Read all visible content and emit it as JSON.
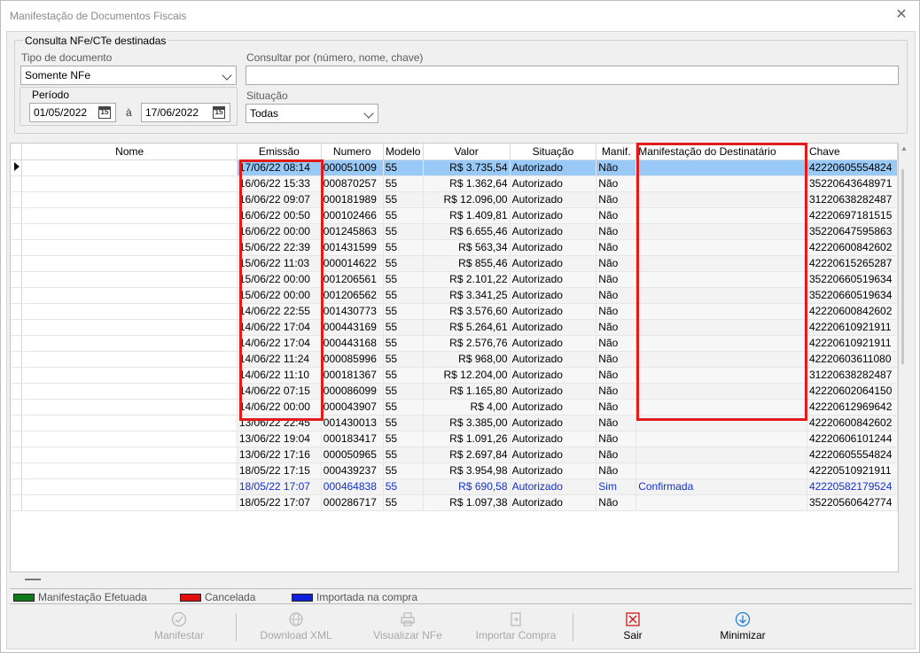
{
  "window": {
    "title": "Manifestação de Documentos Fiscais"
  },
  "filters": {
    "group_title": "Consulta NFe/CTe destinadas",
    "tipo_label": "Tipo de documento",
    "tipo_value": "Somente NFe",
    "consultar_label": "Consultar por (número, nome, chave)",
    "consultar_value": "",
    "periodo_label": "Período",
    "date_from": "01/05/2022",
    "date_sep": "à",
    "date_to": "17/06/2022",
    "calendar_glyph": "15",
    "situacao_label": "Situação",
    "situacao_value": "Todas"
  },
  "grid": {
    "columns": [
      "Nome",
      "Emissão",
      "Numero",
      "Modelo",
      "Valor",
      "Situação",
      "Manif.",
      "Manifestação do Destinatário",
      "Chave"
    ],
    "rows": [
      {
        "nome": "",
        "emissao": "17/06/22 08:14",
        "numero": "000051009",
        "modelo": "55",
        "valor": "R$ 3.735,54",
        "situacao": "Autorizado",
        "manif": "Não",
        "manifestacao": "",
        "chave": "42220605554824"
      },
      {
        "nome": "",
        "emissao": "16/06/22 15:33",
        "numero": "000870257",
        "modelo": "55",
        "valor": "R$ 1.362,64",
        "situacao": "Autorizado",
        "manif": "Não",
        "manifestacao": "",
        "chave": "35220643648971"
      },
      {
        "nome": "",
        "emissao": "16/06/22 09:07",
        "numero": "000181989",
        "modelo": "55",
        "valor": "R$ 12.096,00",
        "situacao": "Autorizado",
        "manif": "Não",
        "manifestacao": "",
        "chave": "31220638282487"
      },
      {
        "nome": "",
        "emissao": "16/06/22 00:50",
        "numero": "000102466",
        "modelo": "55",
        "valor": "R$ 1.409,81",
        "situacao": "Autorizado",
        "manif": "Não",
        "manifestacao": "",
        "chave": "42220697181515"
      },
      {
        "nome": "",
        "emissao": "16/06/22 00:00",
        "numero": "001245863",
        "modelo": "55",
        "valor": "R$ 6.655,46",
        "situacao": "Autorizado",
        "manif": "Não",
        "manifestacao": "",
        "chave": "35220647595863"
      },
      {
        "nome": "",
        "emissao": "15/06/22 22:39",
        "numero": "001431599",
        "modelo": "55",
        "valor": "R$ 563,34",
        "situacao": "Autorizado",
        "manif": "Não",
        "manifestacao": "",
        "chave": "42220600842602"
      },
      {
        "nome": "",
        "emissao": "15/06/22 11:03",
        "numero": "000014622",
        "modelo": "55",
        "valor": "R$ 855,46",
        "situacao": "Autorizado",
        "manif": "Não",
        "manifestacao": "",
        "chave": "42220615265287"
      },
      {
        "nome": "",
        "emissao": "15/06/22 00:00",
        "numero": "001206561",
        "modelo": "55",
        "valor": "R$ 2.101,22",
        "situacao": "Autorizado",
        "manif": "Não",
        "manifestacao": "",
        "chave": "35220660519634"
      },
      {
        "nome": "",
        "emissao": "15/06/22 00:00",
        "numero": "001206562",
        "modelo": "55",
        "valor": "R$ 3.341,25",
        "situacao": "Autorizado",
        "manif": "Não",
        "manifestacao": "",
        "chave": "35220660519634"
      },
      {
        "nome": "",
        "emissao": "14/06/22 22:55",
        "numero": "001430773",
        "modelo": "55",
        "valor": "R$ 3.576,60",
        "situacao": "Autorizado",
        "manif": "Não",
        "manifestacao": "",
        "chave": "42220600842602"
      },
      {
        "nome": "",
        "emissao": "14/06/22 17:04",
        "numero": "000443169",
        "modelo": "55",
        "valor": "R$ 5.264,61",
        "situacao": "Autorizado",
        "manif": "Não",
        "manifestacao": "",
        "chave": "42220610921911"
      },
      {
        "nome": "",
        "emissao": "14/06/22 17:04",
        "numero": "000443168",
        "modelo": "55",
        "valor": "R$ 2.576,76",
        "situacao": "Autorizado",
        "manif": "Não",
        "manifestacao": "",
        "chave": "42220610921911"
      },
      {
        "nome": "",
        "emissao": "14/06/22 11:24",
        "numero": "000085996",
        "modelo": "55",
        "valor": "R$ 968,00",
        "situacao": "Autorizado",
        "manif": "Não",
        "manifestacao": "",
        "chave": "42220603611080"
      },
      {
        "nome": "",
        "emissao": "14/06/22 11:10",
        "numero": "000181367",
        "modelo": "55",
        "valor": "R$ 12.204,00",
        "situacao": "Autorizado",
        "manif": "Não",
        "manifestacao": "",
        "chave": "31220638282487"
      },
      {
        "nome": "",
        "emissao": "14/06/22 07:15",
        "numero": "000086099",
        "modelo": "55",
        "valor": "R$ 1.165,80",
        "situacao": "Autorizado",
        "manif": "Não",
        "manifestacao": "",
        "chave": "42220602064150"
      },
      {
        "nome": "",
        "emissao": "14/06/22 00:00",
        "numero": "000043907",
        "modelo": "55",
        "valor": "R$ 4,00",
        "situacao": "Autorizado",
        "manif": "Não",
        "manifestacao": "",
        "chave": "42220612969642"
      },
      {
        "nome": "",
        "emissao": "13/06/22 22:45",
        "numero": "001430013",
        "modelo": "55",
        "valor": "R$ 3.385,00",
        "situacao": "Autorizado",
        "manif": "Não",
        "manifestacao": "",
        "chave": "42220600842602"
      },
      {
        "nome": "",
        "emissao": "13/06/22 19:04",
        "numero": "000183417",
        "modelo": "55",
        "valor": "R$ 1.091,26",
        "situacao": "Autorizado",
        "manif": "Não",
        "manifestacao": "",
        "chave": "42220606101244"
      },
      {
        "nome": "",
        "emissao": "13/06/22 17:16",
        "numero": "000050965",
        "modelo": "55",
        "valor": "R$ 2.697,84",
        "situacao": "Autorizado",
        "manif": "Não",
        "manifestacao": "",
        "chave": "42220605554824"
      },
      {
        "nome": "",
        "emissao": "18/05/22 17:15",
        "numero": "000439237",
        "modelo": "55",
        "valor": "R$ 3.954,98",
        "situacao": "Autorizado",
        "manif": "Não",
        "manifestacao": "",
        "chave": "42220510921911"
      },
      {
        "nome": "",
        "emissao": "18/05/22 17:07",
        "numero": "000464838",
        "modelo": "55",
        "valor": "R$ 690,58",
        "situacao": "Autorizado",
        "manif": "Sim",
        "manifestacao": "Confirmada",
        "chave": "42220582179524"
      },
      {
        "nome": "",
        "emissao": "18/05/22 17:07",
        "numero": "000286717",
        "modelo": "55",
        "valor": "R$ 1.097,38",
        "situacao": "Autorizado",
        "manif": "Não",
        "manifestacao": "",
        "chave": "35220560642774"
      }
    ],
    "selected_row": 0,
    "imported_row": 20
  },
  "legend": [
    {
      "label": "Manifestação Efetuada",
      "color": "#0f7a18"
    },
    {
      "label": "Cancelada",
      "color": "#e01010"
    },
    {
      "label": "Importada na compra",
      "color": "#1020d8"
    }
  ],
  "toolbar": {
    "manifestar": "Manifestar",
    "download_xml": "Download XML",
    "visualizar_nfe": "Visualizar NFe",
    "importar_compra": "Importar Compra",
    "sair": "Sair",
    "minimizar": "Minimizar"
  },
  "colors": {
    "selection": "#99c9f6",
    "highlight_box": "#e21b1b",
    "imported_text": "#1531c9"
  }
}
